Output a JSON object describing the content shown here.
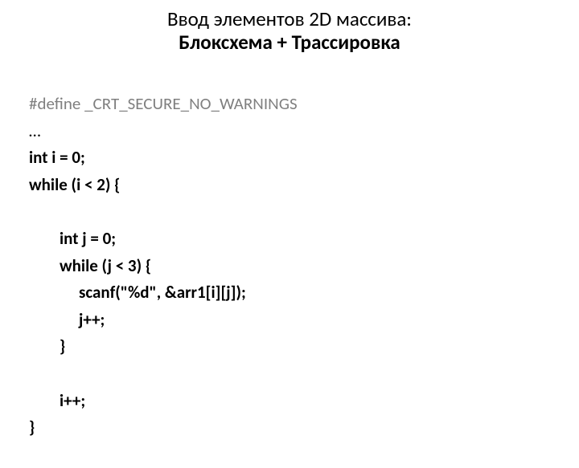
{
  "title": {
    "line1": "Ввод элементов 2D массива:",
    "line2": "Блоксхема + Трассировка"
  },
  "code": {
    "l1": "#define _CRT_SECURE_NO_WARNINGS",
    "l2": "…",
    "l3": "int i = 0;",
    "l4": "while (i < 2) {",
    "l5": "",
    "l6": "int j = 0;",
    "l7": "while (j < 3) {",
    "l8": "scanf(\"%d\", &arr1[i][j]);",
    "l9": "j++;",
    "l10": "}",
    "l11": "",
    "l12": "i++;",
    "l13": "}"
  }
}
